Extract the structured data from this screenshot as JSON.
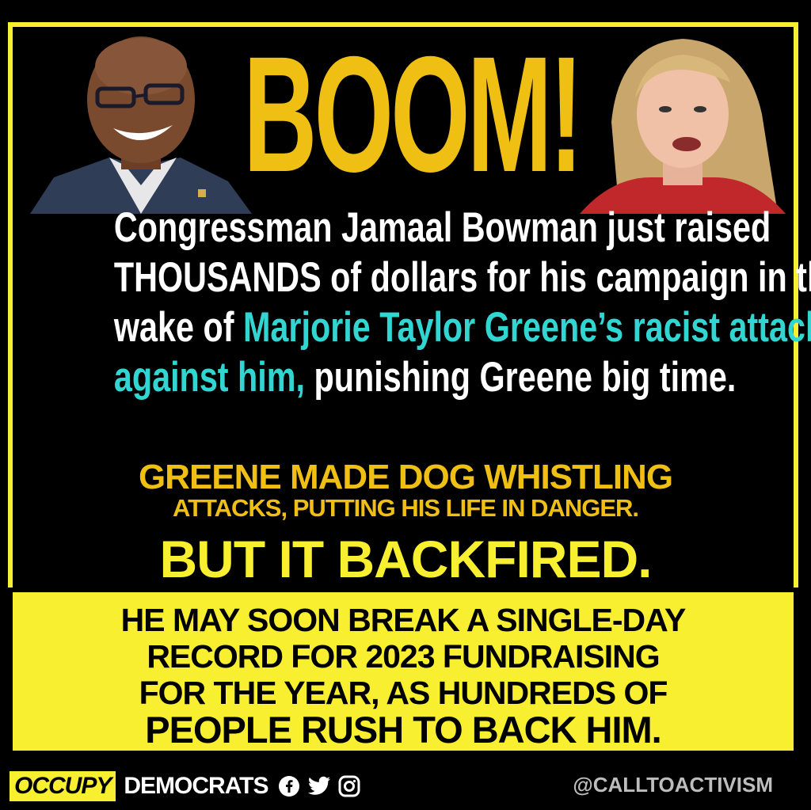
{
  "headline": "BOOM!",
  "body": {
    "line1": "Congressman Jamaal Bowman just raised",
    "line2": "THOUSANDS of dollars for his campaign in the",
    "line3_prefix": "wake of ",
    "line3_highlight": "Marjorie Taylor Greene’s racist attacks",
    "line4_highlight": "against him,",
    "line4_rest": " punishing Greene big time."
  },
  "gold": {
    "line1": "GREENE MADE DOG WHISTLING",
    "line2": "ATTACKS, PUTTING HIS LIFE IN DANGER."
  },
  "backfired": "BUT IT BACKFIRED.",
  "yellow_box": {
    "line1": "HE MAY SOON BREAK A SINGLE-DAY",
    "line2": "RECORD FOR 2023 FUNDRAISING",
    "line3": "FOR THE YEAR, AS HUNDREDS OF",
    "line4": "PEOPLE RUSH TO BACK HIM."
  },
  "footer": {
    "logo_part1": "OCCUPY",
    "logo_part2": "DEMOCRATS",
    "handle": "@CALLTOACTIVISM",
    "icons": [
      "facebook-icon",
      "twitter-icon",
      "instagram-icon"
    ]
  },
  "colors": {
    "headline_gold": "#efbf14",
    "frame_yellow": "#f7ef2f",
    "highlight_cyan": "#31d6d2",
    "background": "#000000"
  }
}
